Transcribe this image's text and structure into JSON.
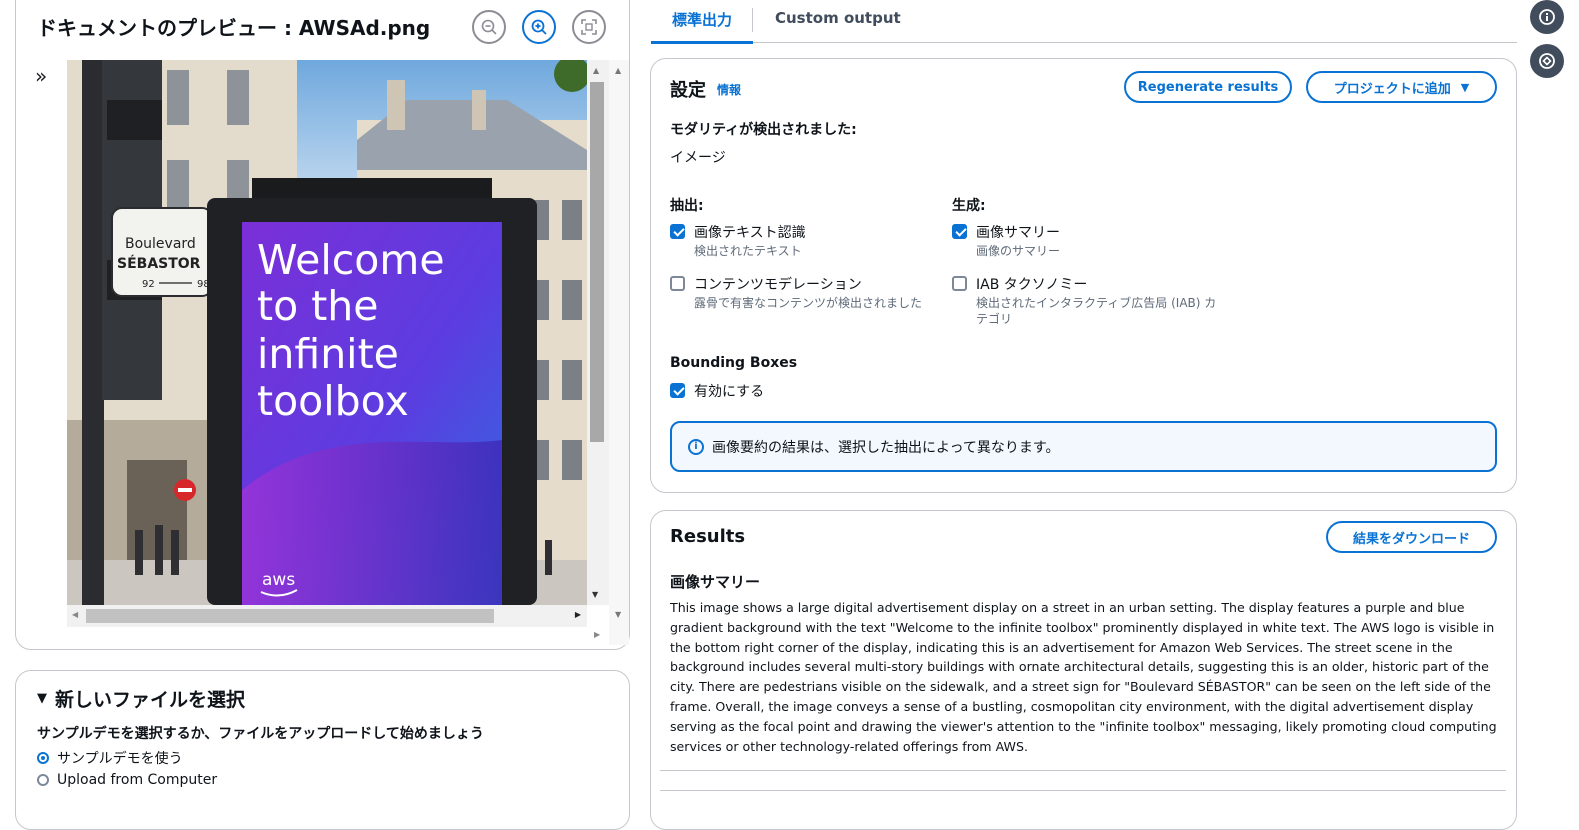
{
  "preview": {
    "title": "ドキュメントのプレビュー : AWSAd.png",
    "zoom_out_icon": "zoom-out-icon",
    "zoom_in_icon": "zoom-in-icon",
    "fit_icon": "fit-to-screen-icon",
    "expand_icon": "double-chevron-right-icon",
    "image": {
      "sign_line1": "Boulevard",
      "sign_line2": "SÉBASTOR",
      "sign_numbers_left": "92",
      "sign_numbers_right": "98",
      "ad_line1": "Welcome",
      "ad_line2": "to the",
      "ad_line3": "infinite",
      "ad_line4": "toolbox",
      "ad_logo": "aws"
    }
  },
  "new_file": {
    "title": "新しいファイルを選択",
    "description": "サンプルデモを選択するか、ファイルをアップロードして始めましょう",
    "options": [
      {
        "label": "サンプルデモを使う",
        "selected": true
      },
      {
        "label": "Upload from Computer",
        "selected": false
      }
    ]
  },
  "tabs": [
    {
      "label": "標準出力",
      "active": true
    },
    {
      "label": "Custom output",
      "active": false
    }
  ],
  "settings": {
    "title": "設定",
    "info_link": "情報",
    "regenerate_label": "Regenerate results",
    "add_to_project_label": "プロジェクトに追加",
    "modality_heading": "モダリティが検出されました:",
    "modality_value": "イメージ",
    "extraction_heading": "抽出:",
    "generation_heading": "生成:",
    "extraction_options": [
      {
        "label": "画像テキスト認識",
        "desc": "検出されたテキスト",
        "checked": true
      },
      {
        "label": "コンテンツモデレーション",
        "desc": "露骨で有害なコンテンツが検出されました",
        "checked": false
      }
    ],
    "generation_options": [
      {
        "label": "画像サマリー",
        "desc": "画像のサマリー",
        "checked": true
      },
      {
        "label": "IAB タクソノミー",
        "desc_line1": "検出されたインタラクティブ広告局 (IAB) カ",
        "desc_line2": "テゴリ",
        "checked": false
      }
    ],
    "bounding_heading": "Bounding Boxes",
    "bounding_option": {
      "label": "有効にする",
      "checked": true
    },
    "alert_text": "画像要約の結果は、選択した抽出によって異なります。"
  },
  "results": {
    "title": "Results",
    "download_label": "結果をダウンロード",
    "summary_heading": "画像サマリー",
    "summary_text": "This image shows a large digital advertisement display on a street in an urban setting. The display features a purple and blue gradient background with the text \"Welcome to the infinite toolbox\" prominently displayed in white text. The AWS logo is visible in the bottom right corner of the display, indicating this is an advertisement for Amazon Web Services. The street scene in the background includes several multi-story buildings with ornate architectural details, suggesting this is an older, historic part of the city. There are pedestrians visible on the sidewalk, and a street sign for \"Boulevard SÉBASTOR\" can be seen on the left side of the frame. Overall, the image conveys a sense of a bustling, cosmopolitan city environment, with the digital advertisement display serving as the focal point and drawing the viewer's attention to the \"infinite toolbox\" messaging, likely promoting cloud computing services or other technology-related offerings from AWS."
  },
  "side_icons": [
    "info-icon",
    "feedback-icon"
  ],
  "colors": {
    "accent": "#0972d3",
    "border": "#c6c6cd",
    "text": "#0f141a",
    "muted": "#5f6b7a"
  }
}
